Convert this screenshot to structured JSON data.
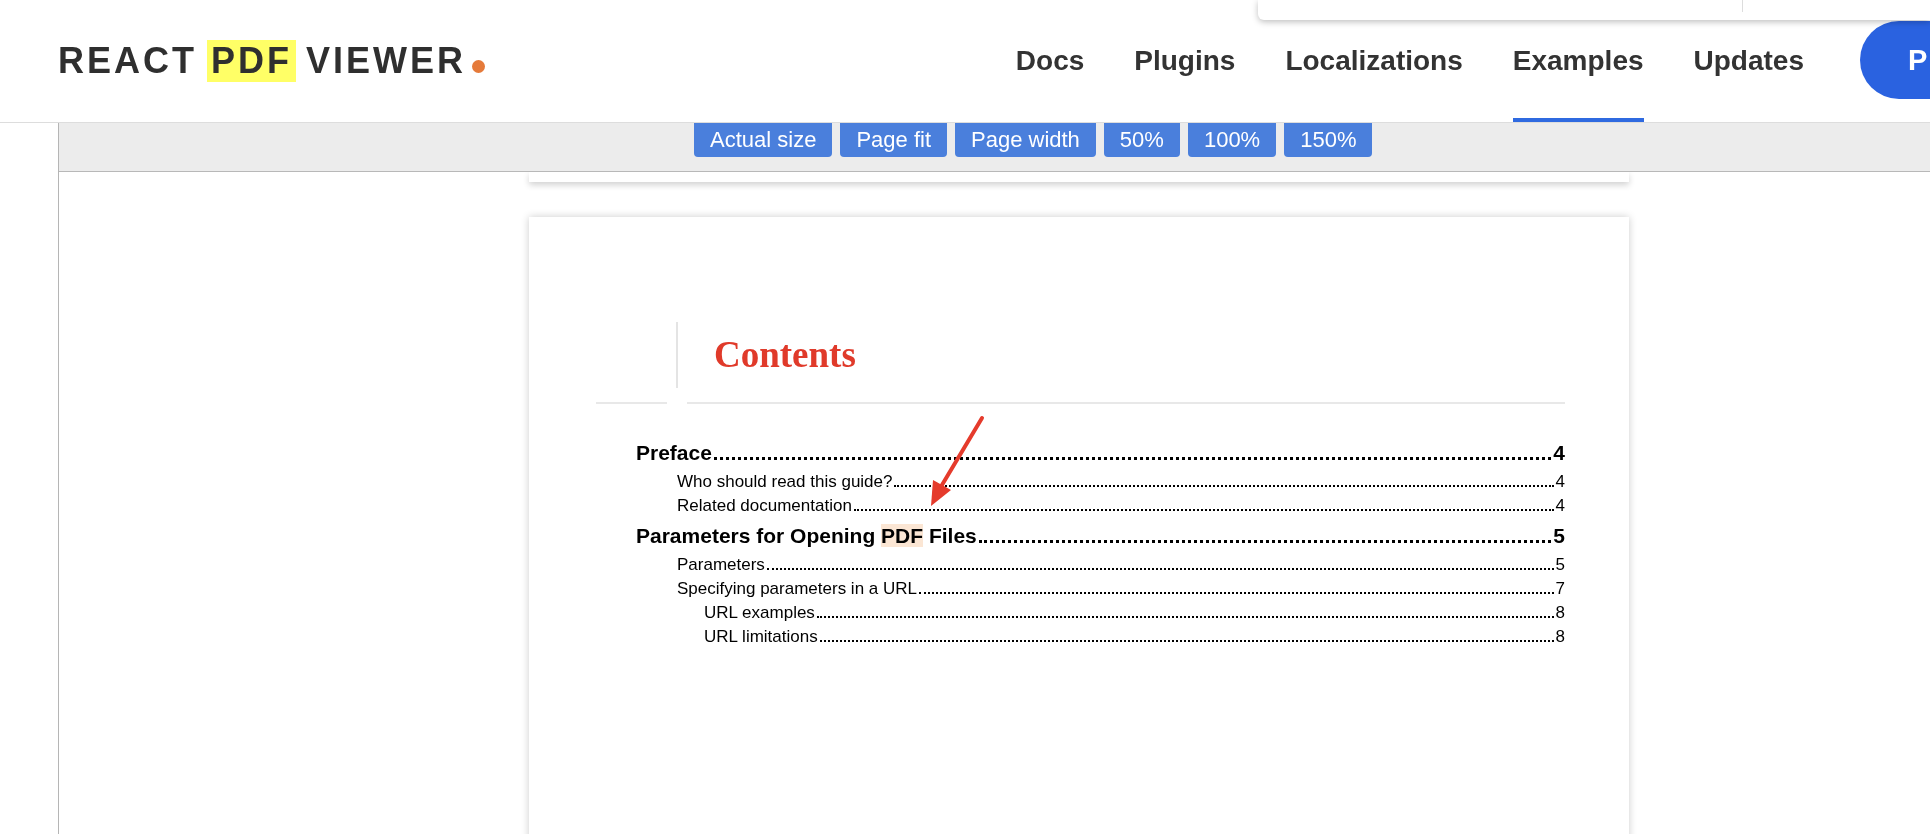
{
  "logo": {
    "parts": [
      {
        "text": "REACT",
        "highlighted": false
      },
      {
        "text": "PDF",
        "highlighted": true
      },
      {
        "text": "VIEWER",
        "highlighted": false
      }
    ]
  },
  "nav": [
    {
      "label": "Docs",
      "selected": false
    },
    {
      "label": "Plugins",
      "selected": false
    },
    {
      "label": "Localizations",
      "selected": false
    },
    {
      "label": "Examples",
      "selected": true
    },
    {
      "label": "Updates",
      "selected": false
    }
  ],
  "cta_button": {
    "label": "P"
  },
  "toolbar": {
    "buttons": [
      "Actual size",
      "Page fit",
      "Page width",
      "50%",
      "100%",
      "150%"
    ]
  },
  "document": {
    "title": "Contents",
    "toc": [
      {
        "title_parts": [
          {
            "text": "Preface",
            "highlighted": false
          }
        ],
        "page": "4",
        "children": [
          {
            "title_parts": [
              {
                "text": "Who should read this guide?",
                "highlighted": false
              }
            ],
            "page": "4"
          },
          {
            "title_parts": [
              {
                "text": "Related documentation",
                "highlighted": false
              }
            ],
            "page": "4"
          }
        ]
      },
      {
        "title_parts": [
          {
            "text": "Parameters for Opening ",
            "highlighted": false
          },
          {
            "text": "PDF",
            "highlighted": true
          },
          {
            "text": " Files",
            "highlighted": false
          }
        ],
        "page": "5",
        "children": [
          {
            "title_parts": [
              {
                "text": "Parameters",
                "highlighted": false
              }
            ],
            "page": "5"
          },
          {
            "title_parts": [
              {
                "text": "Specifying parameters in a URL",
                "highlighted": false
              }
            ],
            "page": "7",
            "children": [
              {
                "title_parts": [
                  {
                    "text": "URL examples",
                    "highlighted": false
                  }
                ],
                "page": "8"
              },
              {
                "title_parts": [
                  {
                    "text": "URL limitations",
                    "highlighted": false
                  }
                ],
                "page": "8"
              }
            ]
          }
        ]
      }
    ]
  }
}
